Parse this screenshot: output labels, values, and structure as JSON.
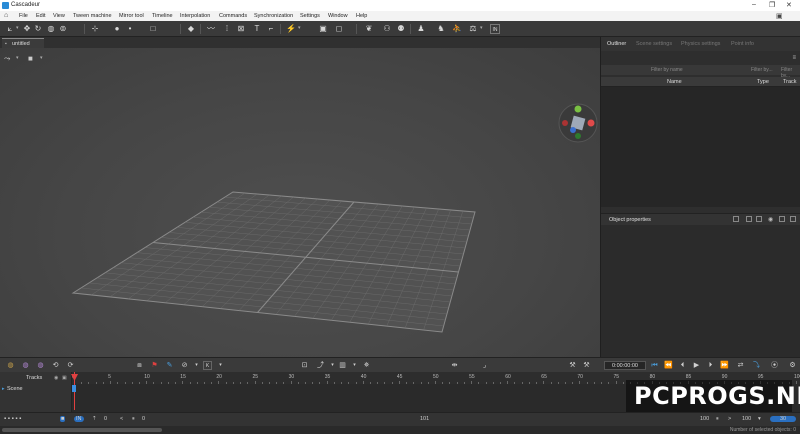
{
  "window": {
    "title": "Cascadeur",
    "controls": [
      "–",
      "❐",
      "✕"
    ]
  },
  "menu": [
    "File",
    "Edit",
    "View",
    "Tween machine",
    "Mirror tool",
    "Timeline",
    "Interpolation",
    "Commands",
    "Synchronization",
    "Settings",
    "Window",
    "Help"
  ],
  "tabs": {
    "document": "untitled"
  },
  "right_panel": {
    "tabs": [
      "Outliner",
      "Scene settings",
      "Physics settings",
      "Point info"
    ],
    "active_tab": "Outliner",
    "filter_placeholder": "Filter by name",
    "filter2_placeholder": "Filter by...",
    "filter3_placeholder": "Filter by...",
    "columns": {
      "name": "Name",
      "type": "Type",
      "track": "Track"
    },
    "object_properties_title": "Object properties"
  },
  "timeline": {
    "current_time": "0:00:00:00",
    "tracks_label": "Tracks",
    "scene_label": "Scene",
    "ruler_labels": [
      "0",
      "5",
      "10",
      "15",
      "20",
      "25",
      "30",
      "35",
      "40",
      "45",
      "50",
      "55",
      "60",
      "65",
      "70",
      "75",
      "80",
      "85",
      "90",
      "95",
      "100"
    ]
  },
  "status": {
    "left_field_1": "0",
    "left_field_2": "0",
    "center_value": "101",
    "end_frame": "100",
    "fps_value": "100",
    "selected_objects": "Number of selected objects: 0",
    "blue_btn_1": "30",
    "blue_btn_2": "IN"
  },
  "watermark": "PCPROGS.NET",
  "colors": {
    "accent": "#2a6fc0",
    "playhead": "#e04040",
    "viewport": "#4a4a4a"
  }
}
